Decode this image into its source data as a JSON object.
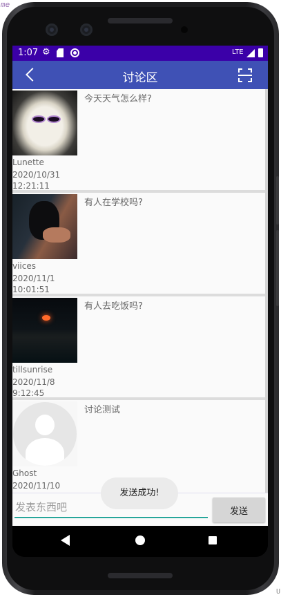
{
  "editor": {
    "hint": "me",
    "corner_hint": "U"
  },
  "status_bar": {
    "time": "1:07",
    "network": "LTE"
  },
  "app_bar": {
    "title": "讨论区"
  },
  "posts": [
    {
      "text": "今天天气怎么样?",
      "user": "Lunette",
      "date": "2020/10/31",
      "time": "12:21:11",
      "avatar": "sunglasses-dog"
    },
    {
      "text": "有人在学校吗?",
      "user": "viices",
      "date": "2020/11/1",
      "time": "10:01:51",
      "avatar": "black-cat"
    },
    {
      "text": "有人去吃饭吗?",
      "user": "tillsunrise",
      "date": "2020/11/8",
      "time": "9:12:45",
      "avatar": "sunset"
    },
    {
      "text": "讨论测试",
      "user": "Ghost",
      "date": "2020/11/10",
      "time": "",
      "avatar": "default-person"
    }
  ],
  "toast": "发送成功!",
  "composer": {
    "placeholder": "发表东西吧",
    "value": "",
    "send_label": "发送"
  },
  "colors": {
    "status_bar": "#3b00a8",
    "app_bar": "#3f51b5",
    "input_underline": "#26a69a"
  }
}
